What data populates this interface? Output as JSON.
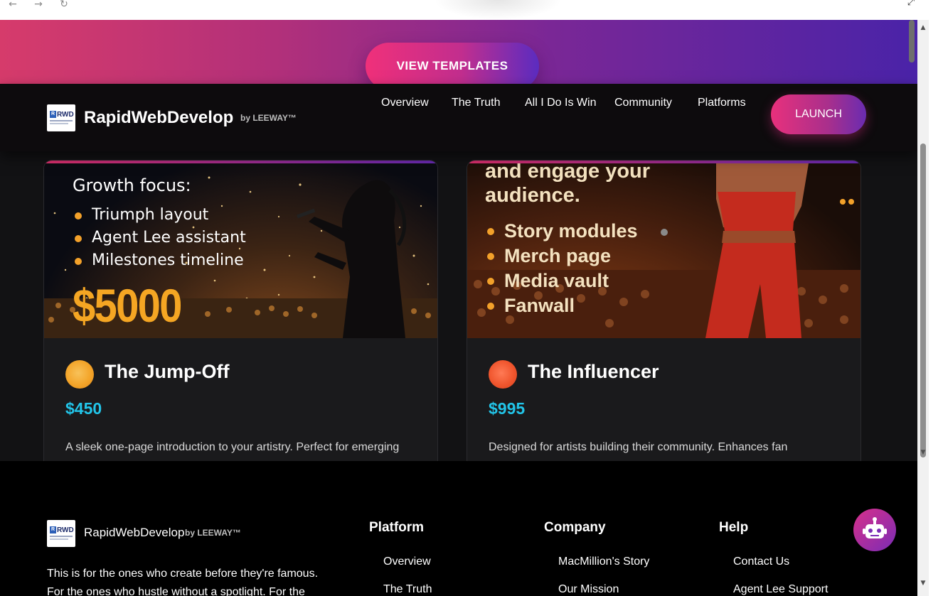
{
  "browser": {
    "back_icon": "←",
    "forward_icon": "→",
    "reload_icon": "↻",
    "fullscreen_icon": "⤢"
  },
  "hero": {
    "cta_label": "VIEW TEMPLATES"
  },
  "header": {
    "logo_text": "RWD",
    "logo_r": "R",
    "brand": "RapidWebDevelop",
    "brand_by": "by LEEWAY™",
    "nav": [
      "Overview",
      "The Truth",
      "All I Do Is Win",
      "Community",
      "Platforms"
    ],
    "launch_label": "LAUNCH"
  },
  "cards": [
    {
      "image_heading": "Growth focus:",
      "image_bullets": [
        "Triumph layout",
        "Agent Lee assistant",
        "Milestones timeline"
      ],
      "image_price": "$5000",
      "title": "The Jump-Off",
      "price": "$450",
      "description": "A sleek one-page introduction to your artistry. Perfect for emerging"
    },
    {
      "image_heading_line1": "and engage your",
      "image_heading_line2": "audience.",
      "image_bullets": [
        "Story modules",
        "Merch page",
        "Media vault",
        "Fanwall"
      ],
      "title": "The Influencer",
      "price": "$995",
      "description": "Designed for artists building their community. Enhances fan"
    }
  ],
  "footer": {
    "logo_text": "RWD",
    "logo_r": "R",
    "brand": "RapidWebDevelop",
    "brand_by": "by LEEWAY™",
    "tagline_line1": "This is for the ones who create before they're famous.",
    "tagline_line2": "For the ones who hustle without a spotlight. For the",
    "columns": [
      {
        "title": "Platform",
        "links": [
          "Overview",
          "The Truth"
        ]
      },
      {
        "title": "Company",
        "links": [
          "MacMillion's Story",
          "Our Mission"
        ]
      },
      {
        "title": "Help",
        "links": [
          "Contact Us",
          "Agent Lee Support"
        ]
      }
    ]
  },
  "chatbot": {
    "icon": "robot-icon"
  },
  "scrollbar": {
    "up": "▲",
    "down": "▼"
  },
  "colors": {
    "accent_pink": "#e8307c",
    "accent_purple": "#6a2cb0",
    "price_cyan": "#22c4e8",
    "bullet_orange": "#f3a12a"
  }
}
